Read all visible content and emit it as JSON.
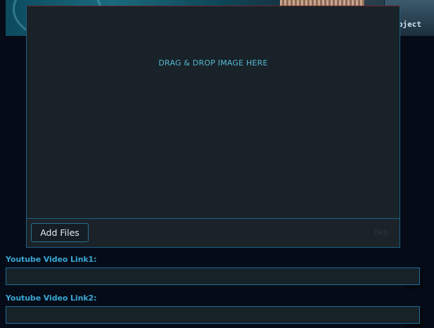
{
  "banner": {
    "label": "Object"
  },
  "uploader": {
    "drop_text": "DRAG & DROP IMAGE HERE",
    "add_files_label": "Add Files",
    "footer_faint": "0kb"
  },
  "fields": [
    {
      "label": "Youtube Video Link1:",
      "value": ""
    },
    {
      "label": "Youtube Video Link2:",
      "value": ""
    }
  ],
  "colors": {
    "accent": "#3aa6d4",
    "background": "#050c17",
    "panel": "#182228",
    "border": "#1f6a96"
  }
}
